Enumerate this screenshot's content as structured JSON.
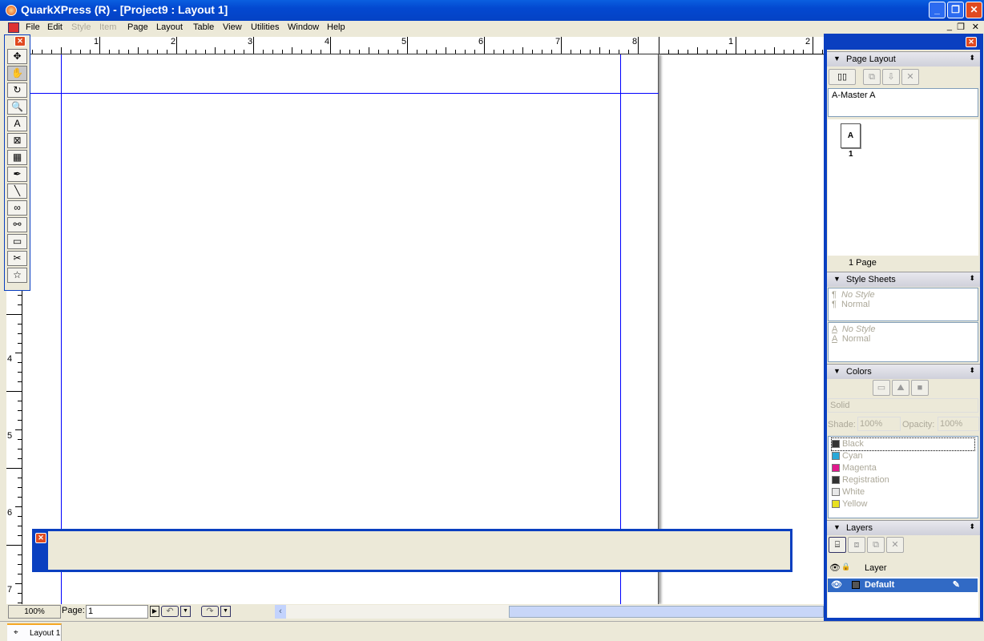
{
  "title": "QuarkXPress (R) - [Project9 : Layout 1]",
  "menu": [
    {
      "label": "File",
      "disabled": false
    },
    {
      "label": "Edit",
      "disabled": false
    },
    {
      "label": "Style",
      "disabled": true
    },
    {
      "label": "Item",
      "disabled": true
    },
    {
      "label": "Page",
      "disabled": false
    },
    {
      "label": "Layout",
      "disabled": false
    },
    {
      "label": "Table",
      "disabled": false
    },
    {
      "label": "View",
      "disabled": false
    },
    {
      "label": "Utilities",
      "disabled": false
    },
    {
      "label": "Window",
      "disabled": false
    },
    {
      "label": "Help",
      "disabled": false
    }
  ],
  "hruler": [
    "1",
    "2",
    "3",
    "4",
    "5",
    "6",
    "7",
    "8",
    "1",
    "2"
  ],
  "vruler": [
    "4",
    "5",
    "6",
    "7"
  ],
  "tools": [
    "item-tool",
    "content-tool",
    "rotation-tool",
    "zoom-tool",
    "text-box-tool",
    "picture-box-tool",
    "table-tool",
    "bezier-pen-tool",
    "line-tool",
    "linking-tool",
    "unlinking-tool",
    "composition-zone-tool",
    "scissors-tool",
    "starburst-tool"
  ],
  "bottom": {
    "zoom": "100%",
    "page_label": "Page:",
    "page_value": "1"
  },
  "tab": "Layout 1",
  "page_layout": {
    "title": "Page Layout",
    "master": "A-Master A",
    "page_letter": "A",
    "page_number": "1",
    "page_count": "1 Page"
  },
  "style_sheets": {
    "title": "Style Sheets",
    "paragraph": [
      "No Style",
      "Normal"
    ],
    "character": [
      "No Style",
      "Normal"
    ]
  },
  "colors": {
    "title": "Colors",
    "fill": "Solid",
    "shade_label": "Shade:",
    "shade": "100%",
    "opacity_label": "Opacity:",
    "opacity": "100%",
    "items": [
      {
        "name": "Black",
        "color": "#333333"
      },
      {
        "name": "Cyan",
        "color": "#29a8d8"
      },
      {
        "name": "Magenta",
        "color": "#e0188c"
      },
      {
        "name": "Registration",
        "color": "#333333"
      },
      {
        "name": "White",
        "color": "#e8e8e8"
      },
      {
        "name": "Yellow",
        "color": "#e8e020"
      }
    ]
  },
  "layers": {
    "title": "Layers",
    "column": "Layer",
    "items": [
      {
        "name": "Default"
      }
    ]
  }
}
